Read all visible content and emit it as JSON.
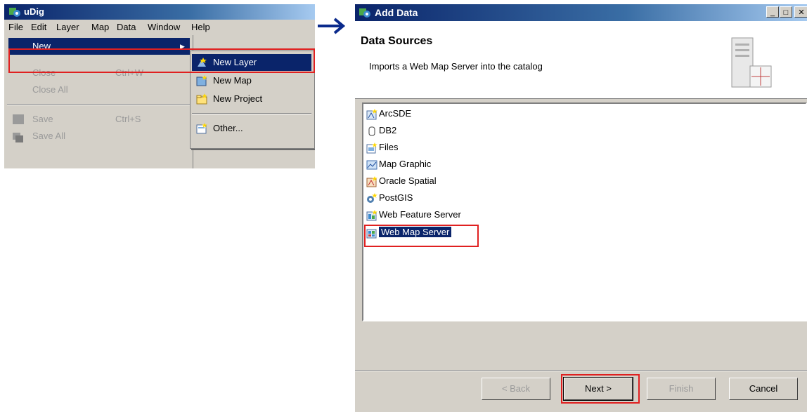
{
  "udig_window": {
    "title": "uDig",
    "menubar": [
      "File",
      "Edit",
      "Layer",
      "Map",
      "Data",
      "Window",
      "Help"
    ],
    "file_menu": {
      "new": "New",
      "close": "Close",
      "close_shortcut": "Ctrl+W",
      "close_all": "Close All",
      "save": "Save",
      "save_shortcut": "Ctrl+S",
      "save_all": "Save All"
    },
    "new_submenu": {
      "new_layer": "New Layer",
      "new_map": "New Map",
      "new_project": "New Project",
      "other": "Other..."
    }
  },
  "dialog": {
    "title": "Add Data",
    "header_title": "Data Sources",
    "header_description": "Imports a Web Map Server into the catalog",
    "sources": [
      "ArcSDE",
      "DB2",
      "Files",
      "Map Graphic",
      "Oracle Spatial",
      "PostGIS",
      "Web Feature Server",
      "Web Map Server"
    ],
    "selected_source": "Web Map Server",
    "buttons": {
      "back": "< Back",
      "next": "Next >",
      "finish": "Finish",
      "cancel": "Cancel"
    }
  },
  "colors": {
    "selection": "#0a246a",
    "highlight_box": "#e02020",
    "arrow": "#0a2a8c"
  }
}
